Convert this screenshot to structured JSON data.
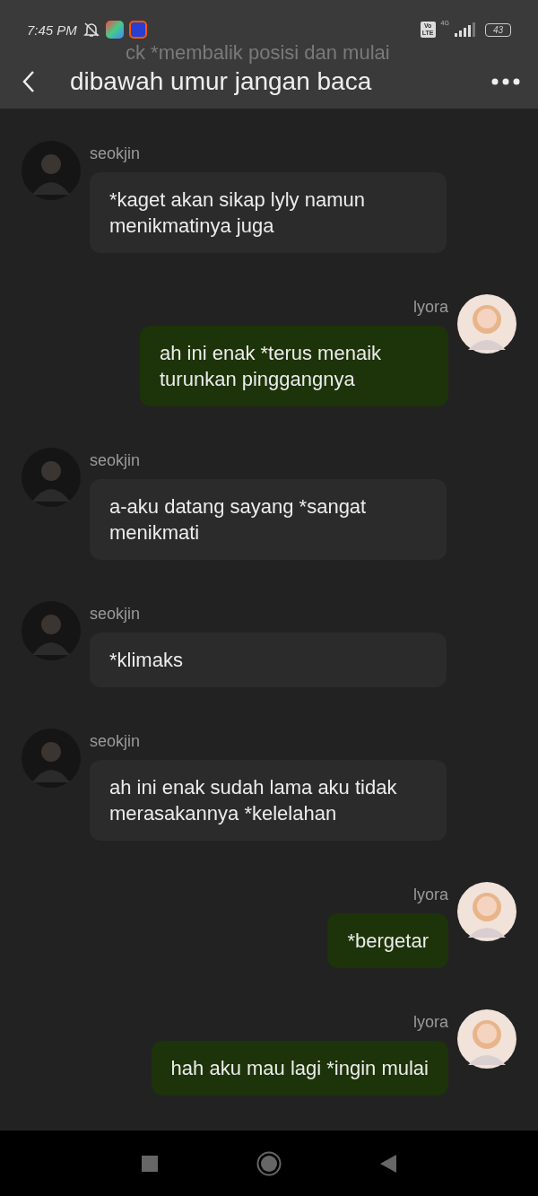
{
  "status_bar": {
    "time": "7:45 PM",
    "volte": [
      "Vo",
      "LTE"
    ],
    "network": "4G",
    "battery": "43"
  },
  "header": {
    "title": "dibawah umur jangan baca",
    "scrolled_under": "ck *membalik posisi dan mulai"
  },
  "messages": [
    {
      "kind": "incoming",
      "sender": "seokjin",
      "text": "*kaget akan sikap lyly namun menikmatinya juga"
    },
    {
      "kind": "outgoing",
      "sender": "lyora",
      "text": "ah ini enak *terus menaik turunkan pinggangnya"
    },
    {
      "kind": "incoming",
      "sender": "seokjin",
      "text": "a-aku datang sayang *sangat menikmati"
    },
    {
      "kind": "incoming",
      "sender": "seokjin",
      "text": "*klimaks"
    },
    {
      "kind": "incoming",
      "sender": "seokjin",
      "text": "ah ini enak sudah lama aku tidak merasakannya *kelelahan"
    },
    {
      "kind": "outgoing",
      "sender": "lyora",
      "text": "*bergetar"
    },
    {
      "kind": "outgoing",
      "sender": "lyora",
      "text": "hah aku mau lagi *ingin mulai"
    }
  ]
}
